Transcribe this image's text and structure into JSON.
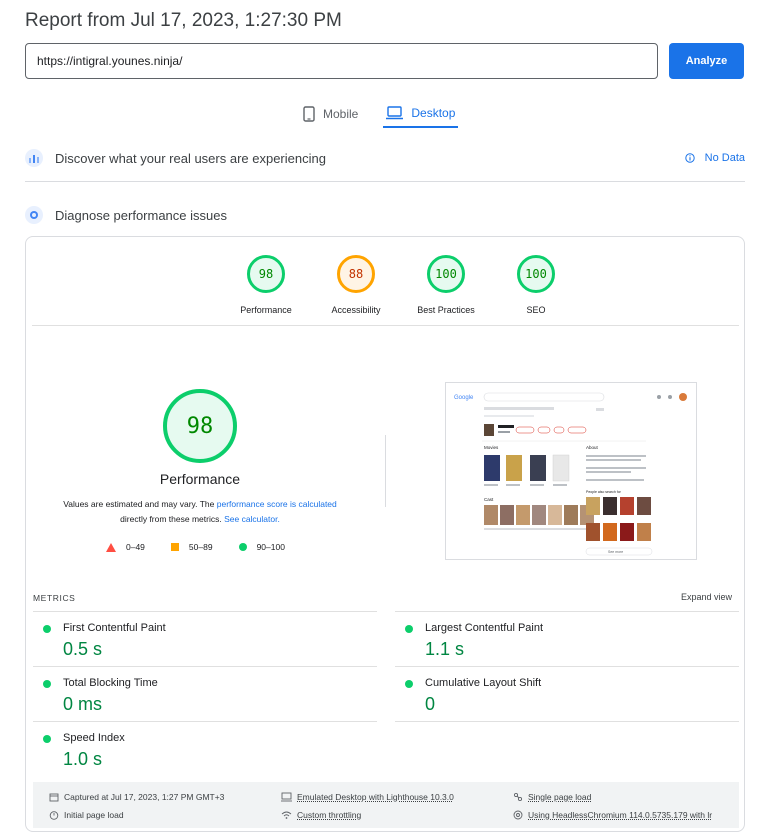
{
  "report": {
    "title": "Report from Jul 17, 2023, 1:27:30 PM"
  },
  "url_bar": {
    "value": "https://intigral.younes.ninja/",
    "analyze_label": "Analyze"
  },
  "tabs": [
    {
      "label": "Mobile"
    },
    {
      "label": "Desktop"
    }
  ],
  "field_section": {
    "text": "Discover what your real users are experiencing",
    "status": "No Data"
  },
  "lab_section": {
    "text": "Diagnose performance issues"
  },
  "categories": [
    {
      "label": "Performance",
      "score": "98"
    },
    {
      "label": "Accessibility",
      "score": "88"
    },
    {
      "label": "Best Practices",
      "score": "100"
    },
    {
      "label": "SEO",
      "score": "100"
    }
  ],
  "main_score": {
    "score": "98",
    "label": "Performance",
    "note_prefix": "Values are estimated and may vary. The ",
    "note_link": "performance score is calculated",
    "note_middle": "directly from these metrics. ",
    "note_link2": "See calculator."
  },
  "legend": [
    {
      "range": "0–49"
    },
    {
      "range": "50–89"
    },
    {
      "range": "90–100"
    }
  ],
  "metrics_header": {
    "label": "METRICS",
    "expand_label": "Expand view"
  },
  "metrics": [
    {
      "title": "First Contentful Paint",
      "value": "0.5 s"
    },
    {
      "title": "Largest Contentful Paint",
      "value": "1.1 s"
    },
    {
      "title": "Total Blocking Time",
      "value": "0 ms"
    },
    {
      "title": "Cumulative Layout Shift",
      "value": "0"
    },
    {
      "title": "Speed Index",
      "value": "1.0 s"
    }
  ],
  "footer": {
    "captured": "Captured at Jul 17, 2023, 1:27 PM GMT+3",
    "emulated": "Emulated Desktop with Lighthouse 10.3.0",
    "single_page": "Single page load",
    "initial": "Initial page load",
    "throttling": "Custom throttling",
    "browser": "Using HeadlessChromium 114.0.5735.179 with lr"
  },
  "thumbnail": {
    "search_logo": "Google",
    "section_movies": "Movies",
    "section_cast": "Cast",
    "section_about": "About",
    "section_related": "People also search for",
    "see_more": "See more"
  },
  "colors": {
    "pass": "#0cce6b",
    "average": "#ffa400",
    "fail": "#ff4e42",
    "accent": "#1a73e8"
  }
}
